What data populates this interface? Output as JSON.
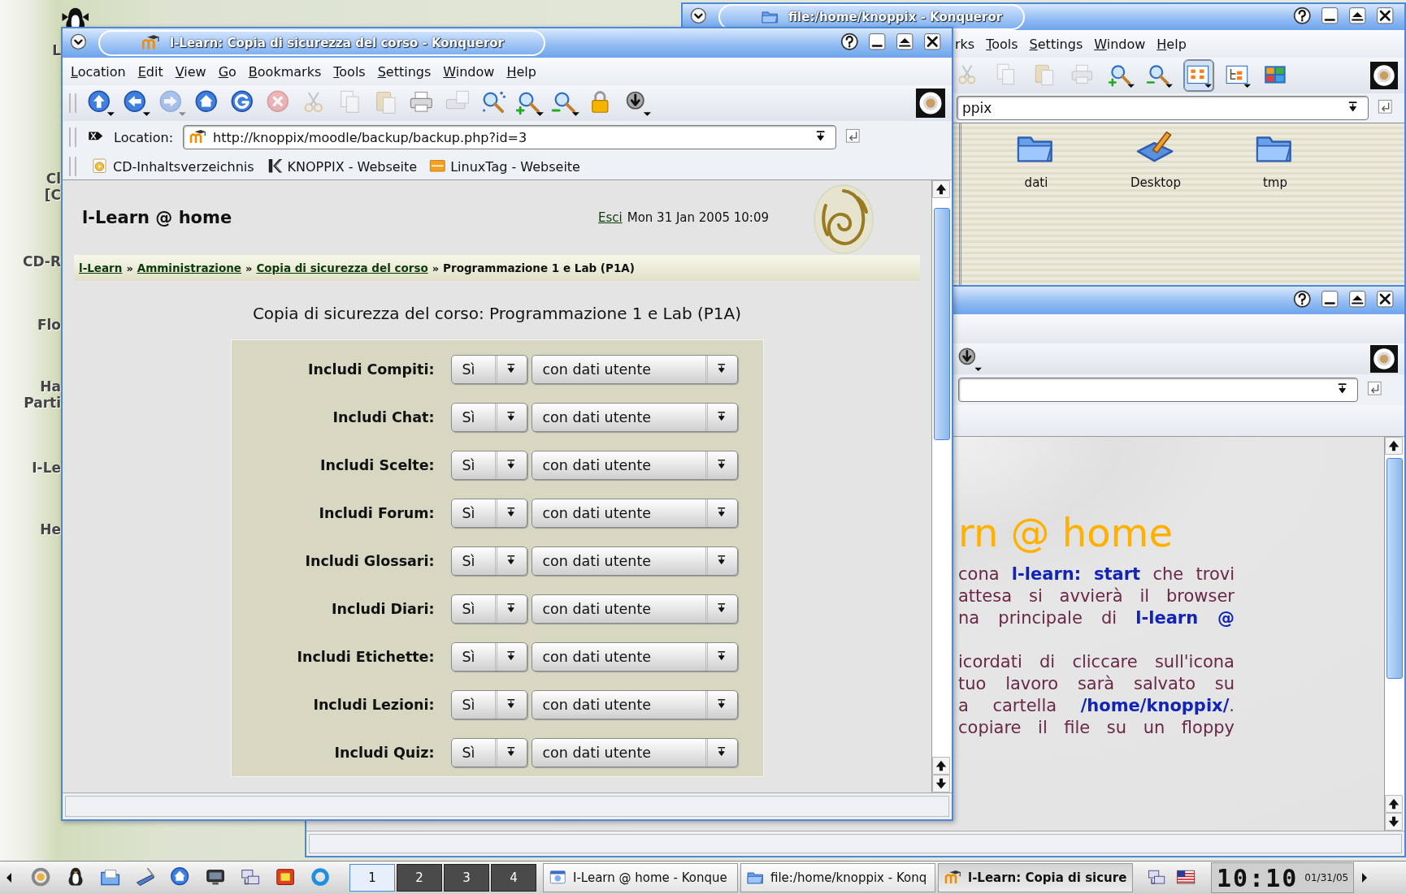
{
  "desktop": {
    "icon_labels": [
      {
        "lines": [
          "L"
        ]
      },
      {
        "lines": [
          "Cl",
          "[C"
        ]
      },
      {
        "lines": [
          "CD-R"
        ]
      },
      {
        "lines": [
          "Flo"
        ]
      },
      {
        "lines": [
          "Ha",
          "Parti"
        ]
      },
      {
        "lines": [
          "I-Le"
        ]
      },
      {
        "lines": [
          "He"
        ]
      }
    ]
  },
  "files_window": {
    "title": "file:/home/knoppix - Konqueror",
    "menu": [
      {
        "label": "rks",
        "mnemonic": false
      },
      {
        "label": "Tools",
        "mnemonic": true
      },
      {
        "label": "Settings",
        "mnemonic": true
      },
      {
        "label": "Window",
        "mnemonic": true
      },
      {
        "label": "Help",
        "mnemonic": true
      }
    ],
    "toolbar": [
      {
        "kind": "cut",
        "disabled": true
      },
      {
        "kind": "copy",
        "disabled": true
      },
      {
        "kind": "paste",
        "disabled": true
      },
      {
        "kind": "print",
        "disabled": true
      },
      {
        "kind": "zoom_in",
        "disabled": false
      },
      {
        "kind": "zoom_out",
        "disabled": false
      }
    ],
    "view_modes": [
      {
        "kind": "view_icons",
        "selected": true
      },
      {
        "kind": "view_tree",
        "selected": false
      },
      {
        "kind": "view_columns",
        "selected": false
      }
    ],
    "location": "ppix",
    "files": [
      {
        "kind": "folder",
        "name": "dati"
      },
      {
        "kind": "desktop",
        "name": "Desktop"
      },
      {
        "kind": "folder",
        "name": "tmp"
      }
    ]
  },
  "start_window": {
    "heading": "rn @ home",
    "paragraphs": [
      [
        "cona **l-learn: start** che trovi",
        "attesa si avvierà il browser",
        "na principale di **l-learn @**"
      ],
      [
        "icordati di cliccare sull'icona",
        "tuo lavoro sarà salvato su",
        "a cartella **/home/knoppix/**.",
        "copiare il file su un floppy"
      ]
    ]
  },
  "main_window": {
    "title": "l-Learn: Copia di sicurezza del corso - Konqueror",
    "menu": [
      {
        "label": "Location",
        "mnemonic": true
      },
      {
        "label": "Edit",
        "mnemonic": true
      },
      {
        "label": "View",
        "mnemonic": true
      },
      {
        "label": "Go",
        "mnemonic": true
      },
      {
        "label": "Bookmarks",
        "mnemonic": true
      },
      {
        "label": "Tools",
        "mnemonic": true
      },
      {
        "label": "Settings",
        "mnemonic": true
      },
      {
        "label": "Window",
        "mnemonic": true
      },
      {
        "label": "Help",
        "mnemonic": true
      }
    ],
    "toolbar": [
      {
        "kind": "up",
        "disabled": false
      },
      {
        "kind": "back",
        "disabled": false
      },
      {
        "kind": "forward",
        "disabled": true
      },
      {
        "kind": "home",
        "disabled": false
      },
      {
        "kind": "reload",
        "disabled": false
      },
      {
        "kind": "stop",
        "disabled": true
      },
      {
        "kind": "cut",
        "disabled": true
      },
      {
        "kind": "copy",
        "disabled": true
      },
      {
        "kind": "paste",
        "disabled": true
      },
      {
        "kind": "print",
        "disabled": false
      },
      {
        "kind": "preview",
        "disabled": true
      },
      {
        "kind": "find",
        "disabled": false
      },
      {
        "kind": "zoom_in",
        "disabled": false
      },
      {
        "kind": "zoom_out",
        "disabled": false
      },
      {
        "kind": "lock",
        "disabled": false
      },
      {
        "kind": "download",
        "disabled": false
      }
    ],
    "location_label": "Location:",
    "url": "http://knoppix/moodle/backup/backup.php?id=3",
    "bookmarks": [
      {
        "kind": "cd",
        "label": "CD-Inhaltsverzeichnis"
      },
      {
        "kind": "knoppix",
        "label": "KNOPPIX - Webseite"
      },
      {
        "kind": "linuxtag",
        "label": "LinuxTag - Webseite"
      }
    ],
    "page": {
      "site_name": "l-Learn @ home",
      "logout": "Esci",
      "date": "Mon 31 Jan 2005 10:09",
      "breadcrumb_separator": "»",
      "breadcrumb": [
        {
          "label": "l-Learn",
          "link": true
        },
        {
          "label": "Amministrazione",
          "link": true
        },
        {
          "label": "Copia di sicurezza del corso",
          "link": true
        },
        {
          "label": "Programmazione 1 e Lab (P1A)",
          "link": false
        }
      ],
      "heading": "Copia di sicurezza del corso: Programmazione 1 e Lab (P1A)",
      "rows": [
        {
          "label": "Includi Compiti:",
          "value": "Sì",
          "user_data": "con dati utente"
        },
        {
          "label": "Includi Chat:",
          "value": "Sì",
          "user_data": "con dati utente"
        },
        {
          "label": "Includi Scelte:",
          "value": "Sì",
          "user_data": "con dati utente"
        },
        {
          "label": "Includi Forum:",
          "value": "Sì",
          "user_data": "con dati utente"
        },
        {
          "label": "Includi Glossari:",
          "value": "Sì",
          "user_data": "con dati utente"
        },
        {
          "label": "Includi Diari:",
          "value": "Sì",
          "user_data": "con dati utente"
        },
        {
          "label": "Includi Etichette:",
          "value": "Sì",
          "user_data": "con dati utente"
        },
        {
          "label": "Includi Lezioni:",
          "value": "Sì",
          "user_data": "con dati utente"
        },
        {
          "label": "Includi Quiz:",
          "value": "Sì",
          "user_data": "con dati utente"
        }
      ]
    }
  },
  "taskbar": {
    "launchers": [
      {
        "kind": "kde"
      },
      {
        "kind": "penguin"
      },
      {
        "kind": "files"
      },
      {
        "kind": "pen"
      },
      {
        "kind": "home"
      },
      {
        "kind": "monitor"
      },
      {
        "kind": "network"
      },
      {
        "kind": "package"
      },
      {
        "kind": "ring"
      }
    ],
    "pager": [
      {
        "label": "1",
        "selected": true
      },
      {
        "label": "2",
        "selected": false
      },
      {
        "label": "3",
        "selected": false
      },
      {
        "label": "4",
        "selected": false
      }
    ],
    "tasks": [
      {
        "kind": "browser",
        "label": "I-Learn @ home - Konque",
        "selected": false
      },
      {
        "kind": "folder",
        "label": "file:/home/knoppix - Konq",
        "selected": false
      },
      {
        "kind": "moodle",
        "label": "l-Learn: Copia di sicure",
        "selected": true
      }
    ],
    "tray": [
      {
        "kind": "network"
      },
      {
        "kind": "flag"
      }
    ],
    "clock": "10:10",
    "date": "01/31/05"
  }
}
